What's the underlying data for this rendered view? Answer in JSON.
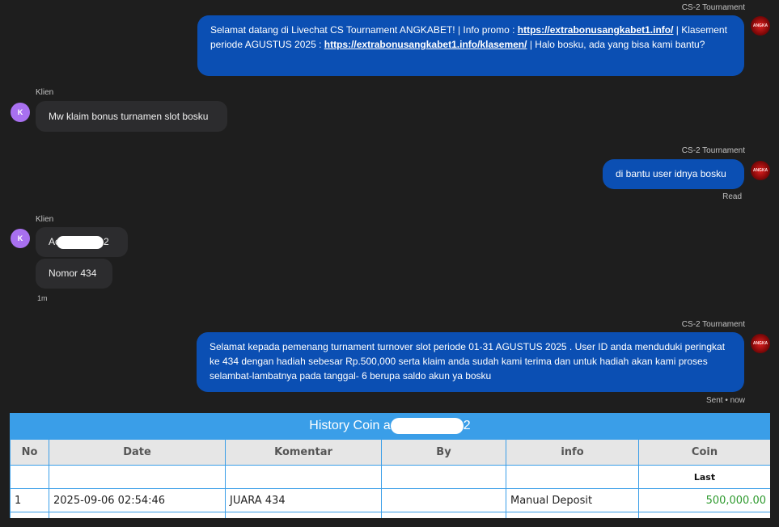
{
  "chat": {
    "msg1": {
      "sender": "CS-2 Tournament",
      "text_a": "Selamat datang di Livechat CS Tournament ANGKABET! | Info promo : ",
      "link1": "https://extrabonusangkabet1.info/",
      "text_b": " | Klasement periode AGUSTUS 2025 : ",
      "link2": "https://extrabonusangkabet1.info/klasemen/",
      "text_c": " | Halo bosku, ada yang bisa kami bantu?"
    },
    "msg2": {
      "sender": "Klien",
      "avatar": "K",
      "text": "Mw klaim bonus turnamen slot bosku"
    },
    "msg3": {
      "sender": "CS-2 Tournament",
      "text": "di bantu user idnya bosku",
      "status": "Read"
    },
    "msg4": {
      "sender": "Klien",
      "avatar": "K",
      "user_prefix": "Ac",
      "user_suffix": "2",
      "text2": "Nomor 434",
      "time": "1m"
    },
    "msg5": {
      "sender": "CS-2 Tournament",
      "text": "Selamat kepada pemenang turnament turnover slot periode 01-31 AGUSTUS 2025 . User ID anda menduduki peringkat ke 434 dengan hadiah sebesar Rp.500,000 serta klaim anda sudah kami terima dan untuk hadiah akan kami proses selambat-lambatnya pada tanggal- 6 berupa saldo akun ya bosku",
      "status": "Sent • now"
    },
    "agent_logo_text": "ANGKA"
  },
  "history": {
    "title_prefix": "History Coin a",
    "title_suffix": "2",
    "columns": [
      "No",
      "Date",
      "Komentar",
      "By",
      "info",
      "Coin"
    ],
    "last_label": "Last",
    "rows": [
      {
        "no": "1",
        "date": "2025-09-06 02:54:46",
        "komentar": "JUARA 434",
        "by": "",
        "info": "Manual Deposit",
        "coin": "500,000.00"
      }
    ]
  },
  "colors": {
    "agent_bubble": "#0b4fb3",
    "client_bubble": "#2c2c2e",
    "client_avatar": "#a870f0",
    "table_header": "#3a9ee8",
    "coin_value": "#2e9a2e"
  }
}
